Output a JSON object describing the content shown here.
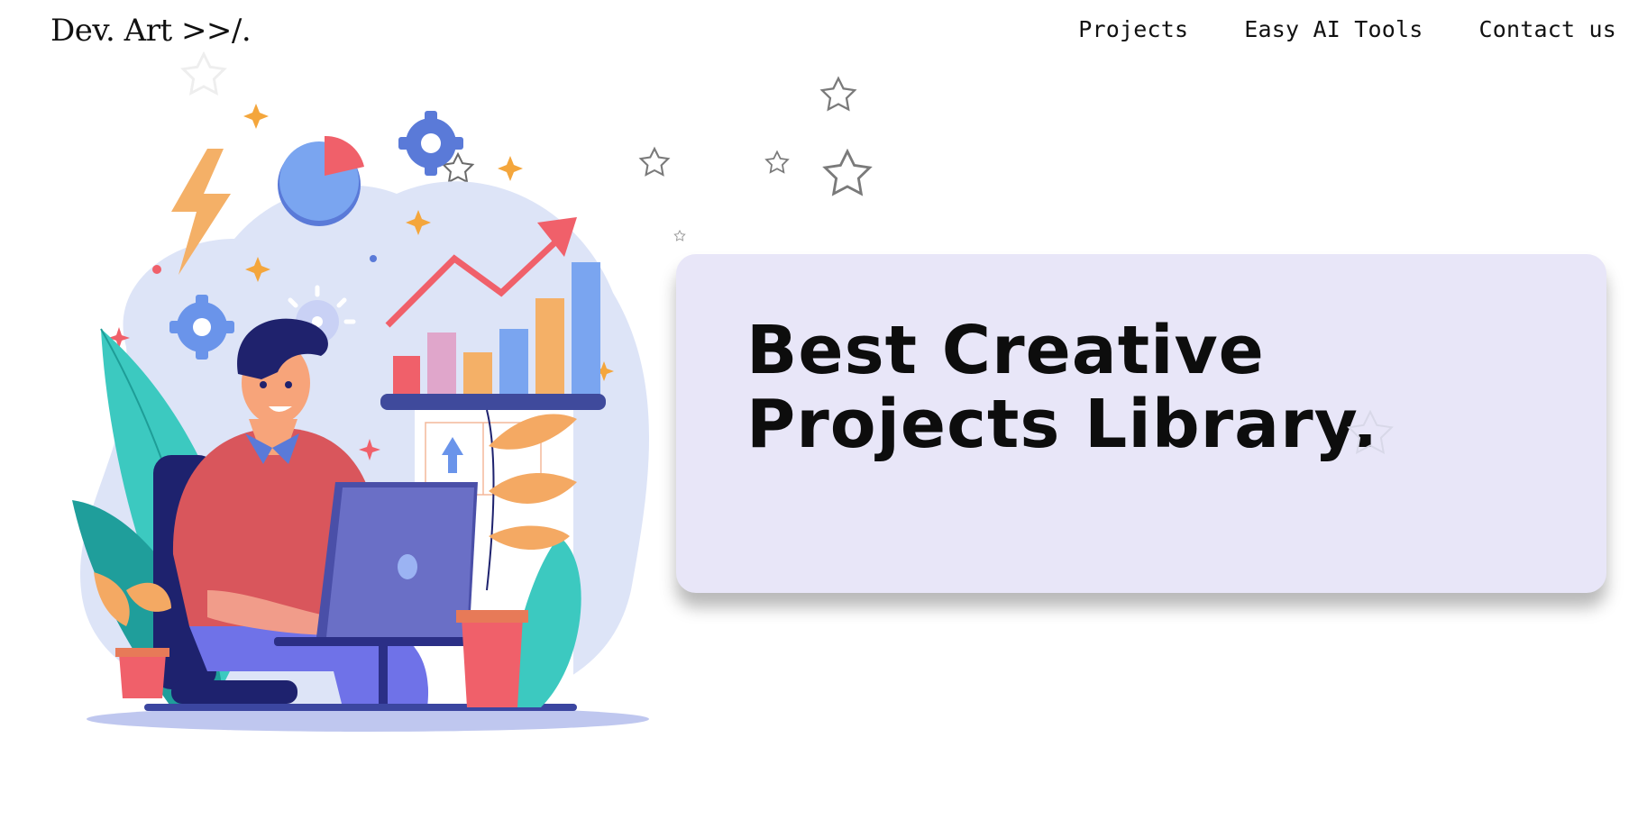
{
  "header": {
    "logo": "Dev. Art >>/.",
    "nav": [
      {
        "label": "Projects"
      },
      {
        "label": "Easy AI Tools"
      },
      {
        "label": "Contact us"
      }
    ]
  },
  "hero": {
    "title": "Best Creative Projects Library."
  },
  "colors": {
    "card_background": "#e8e6f8",
    "text": "#111111",
    "accent_red": "#f0606a",
    "accent_blue": "#7aa5f0",
    "accent_orange": "#f4b067",
    "accent_teal": "#3cc9c0"
  },
  "icons": [
    "star-outline-icon",
    "gear-icon",
    "pie-chart-icon",
    "lightning-icon",
    "trend-arrow-icon",
    "sparkle-icon",
    "upload-arrow-icon"
  ]
}
